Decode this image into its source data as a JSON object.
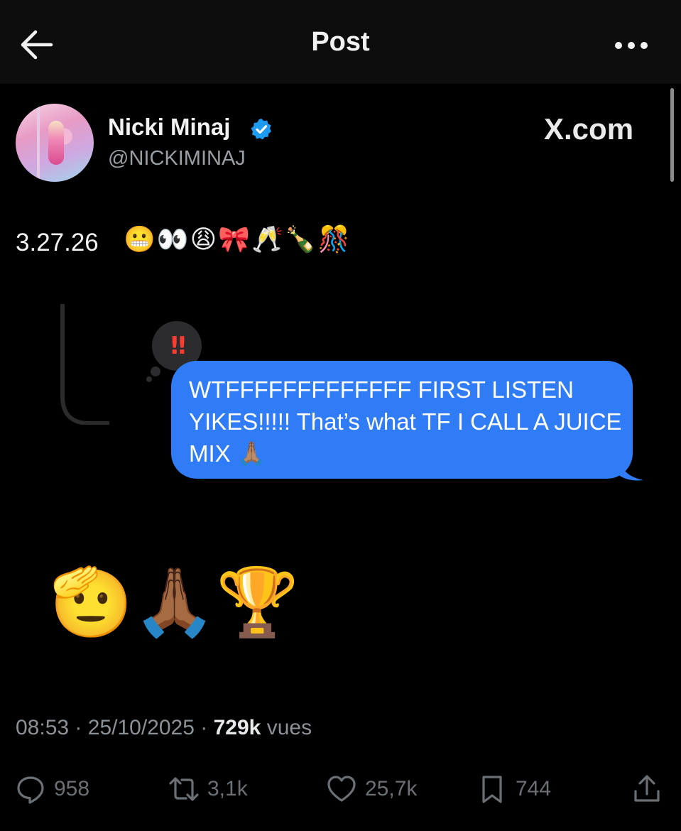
{
  "header": {
    "title": "Post",
    "back_icon": "arrow-left-icon",
    "more_icon": "more-horizontal-icon"
  },
  "author": {
    "name": "Nicki Minaj",
    "handle": "@NICKIMINAJ",
    "verified": true,
    "verified_color": "#1d9bf0"
  },
  "watermark": "X.com",
  "post": {
    "text": "3.27.26",
    "emojis": "😬👀😩🎀🥂🍾🎊"
  },
  "quoted_message": {
    "thought_badge": "‼",
    "thought_badge_color": "#ff3b30",
    "text": "WTFFFFFFFFFFFFF FIRST LISTEN YIKES!!!!! That’s what TF I CALL A JUICE MIX 🙏🏽",
    "bubble_color": "#2f7cf6"
  },
  "reply_emojis": "🫡🙏🏾🏆",
  "meta": {
    "time": "08:53",
    "separator": "·",
    "date": "25/10/2025",
    "views_count": "729k",
    "views_label": "vues"
  },
  "actions": {
    "replies": "958",
    "reposts": "3,1k",
    "likes": "25,7k",
    "bookmarks": "744"
  }
}
